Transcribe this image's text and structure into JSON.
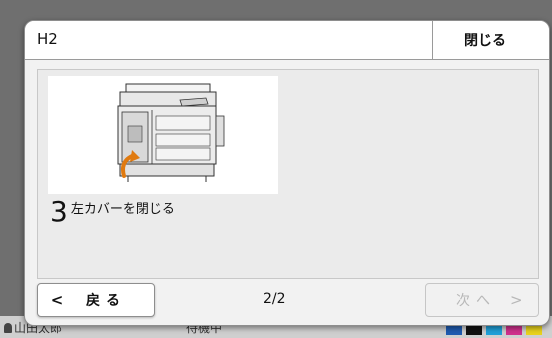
{
  "background": {
    "user_name": "山田太郎",
    "status": "待機中",
    "toner_colors": [
      "#1f5bb0",
      "#111111",
      "#1fa0d8",
      "#d0308c",
      "#e8d21c"
    ]
  },
  "dialog": {
    "title": "H2",
    "close_label": "閉じる",
    "step": {
      "number": "3",
      "instruction": "左カバーを閉じる"
    },
    "footer": {
      "back_label": "戻る",
      "back_chevron": "<",
      "page": "2/2",
      "next_label": "次へ",
      "next_chevron": ">"
    }
  }
}
